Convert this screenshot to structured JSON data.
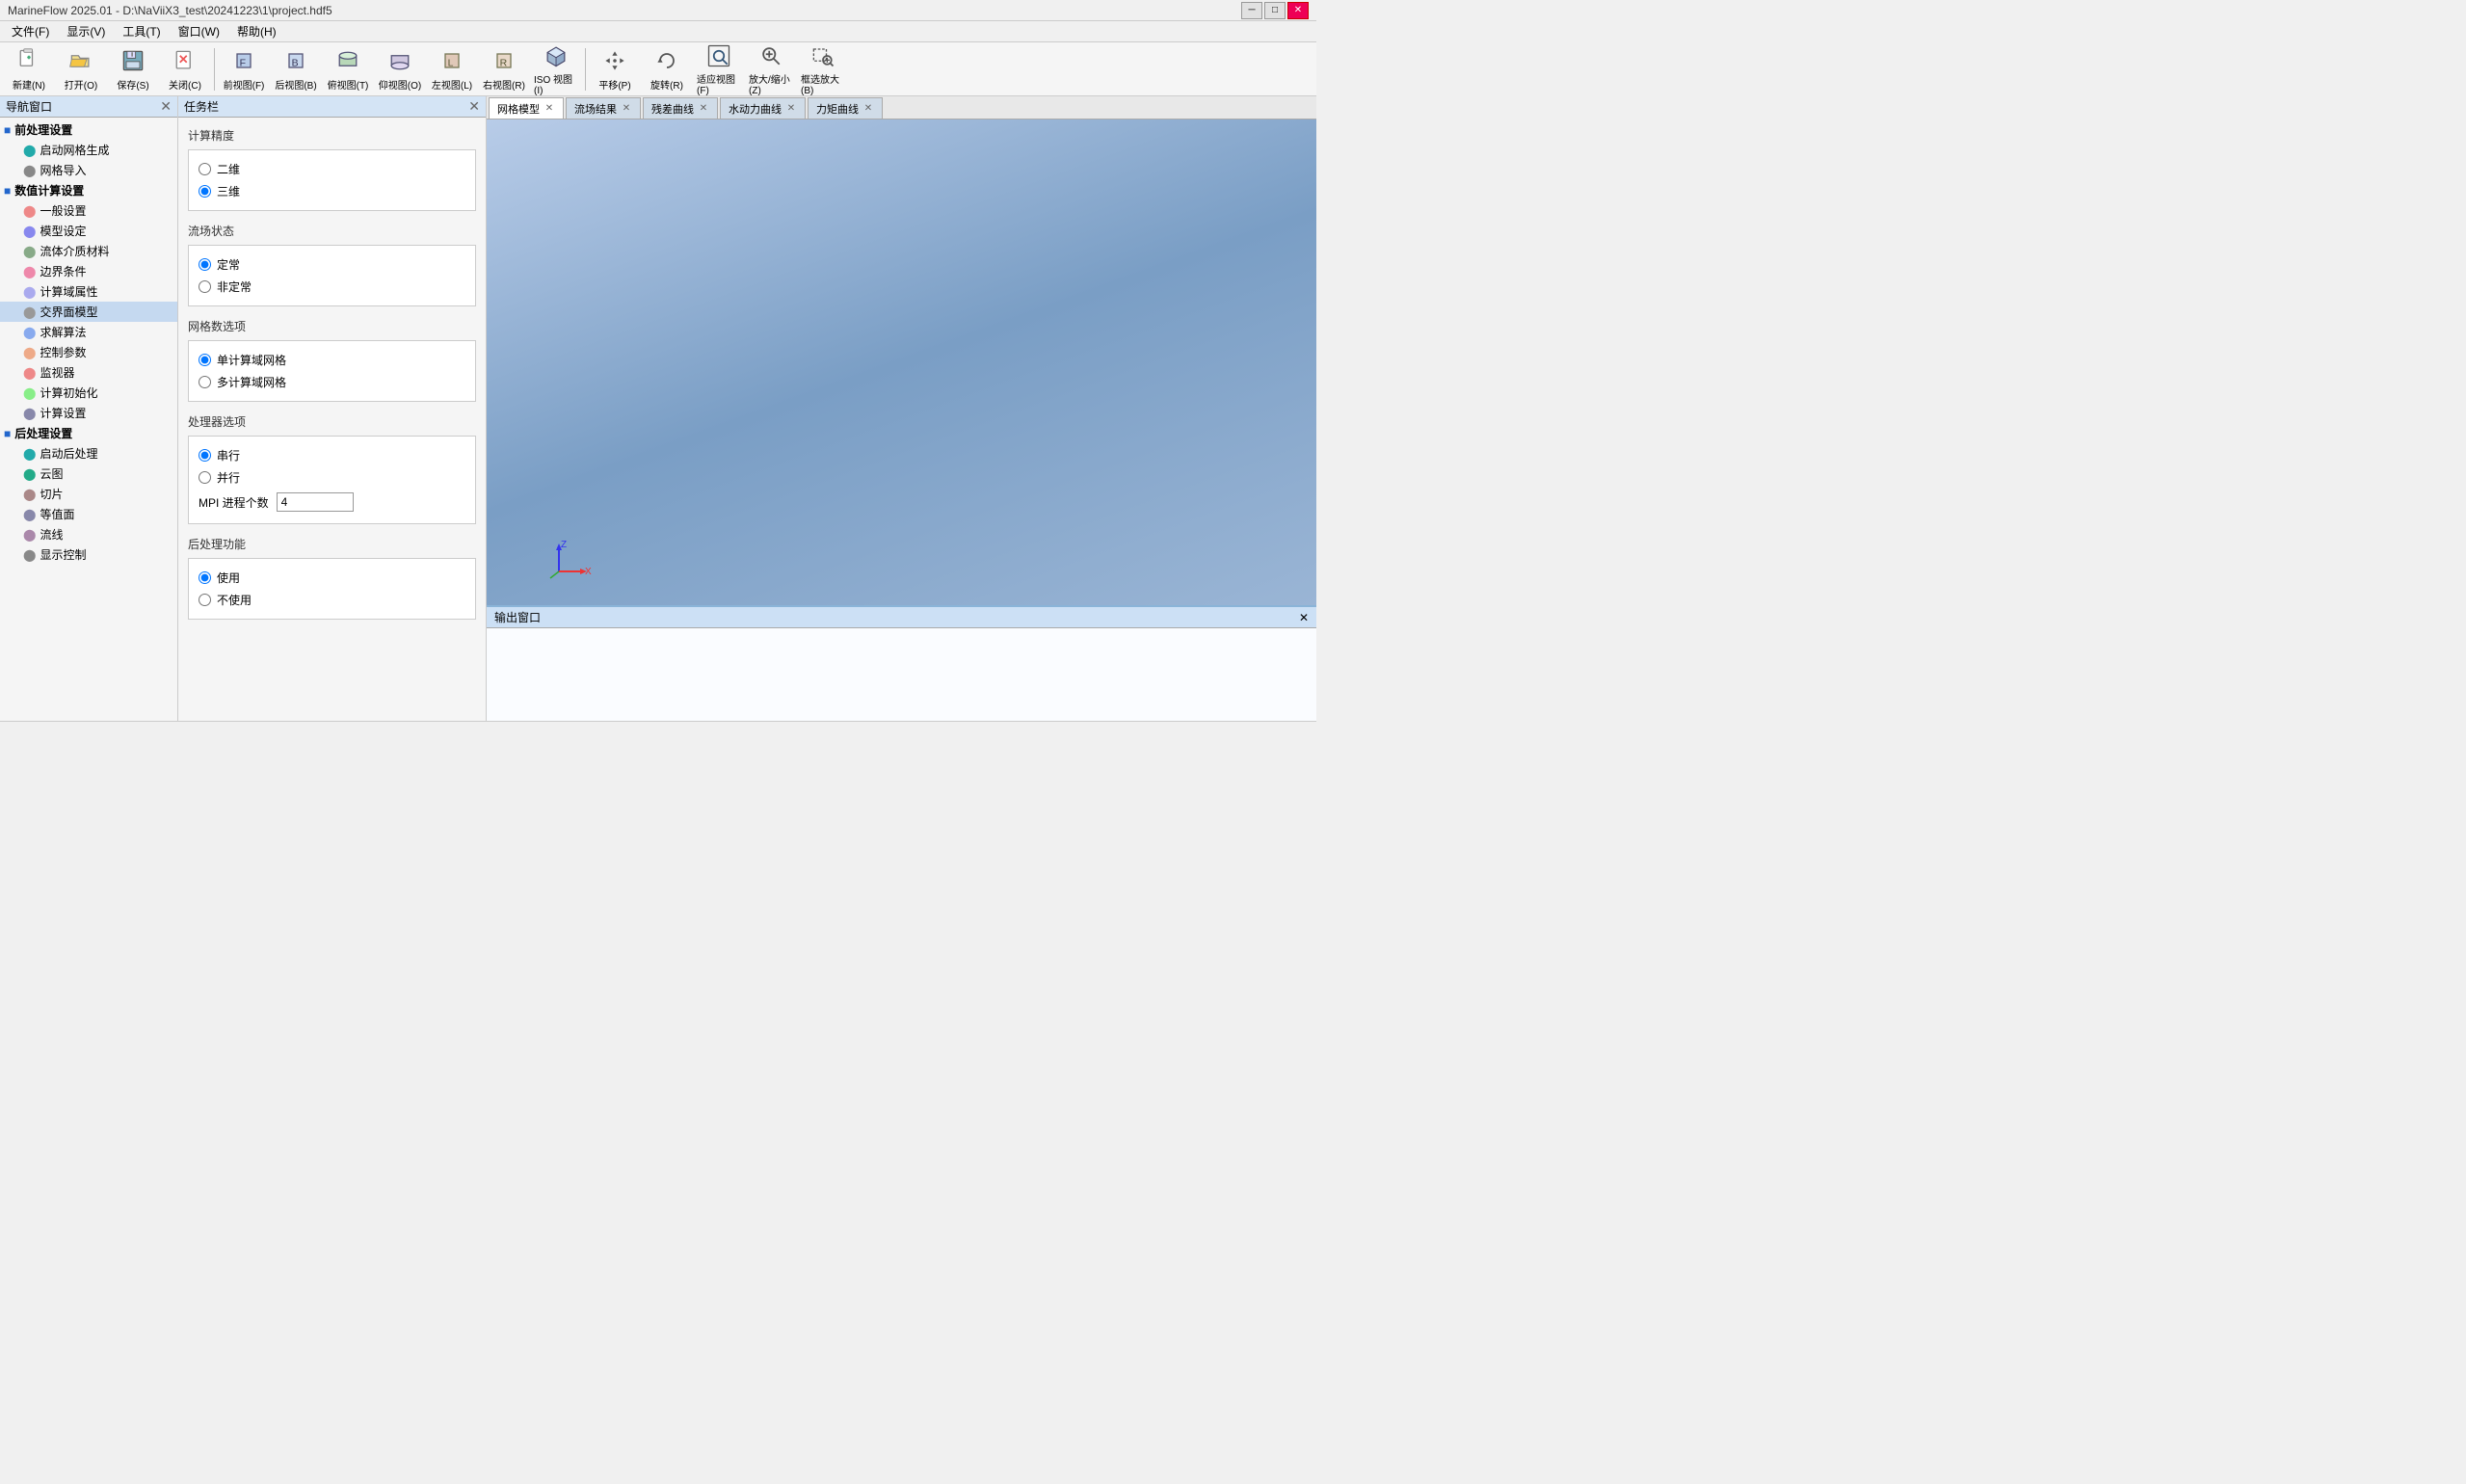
{
  "titleBar": {
    "title": "MarineFlow 2025.01 - D:\\NaViiX3_test\\20241223\\1\\project.hdf5",
    "minBtn": "─",
    "maxBtn": "□",
    "closeBtn": "✕"
  },
  "menuBar": {
    "items": [
      {
        "id": "file",
        "label": "文件(F)"
      },
      {
        "id": "view",
        "label": "显示(V)"
      },
      {
        "id": "tools",
        "label": "工具(T)"
      },
      {
        "id": "window",
        "label": "窗口(W)"
      },
      {
        "id": "help",
        "label": "帮助(H)"
      }
    ]
  },
  "toolbar": {
    "buttons": [
      {
        "id": "new",
        "label": "新建(N)"
      },
      {
        "id": "open",
        "label": "打开(O)"
      },
      {
        "id": "save",
        "label": "保存(S)"
      },
      {
        "id": "close",
        "label": "关闭(C)"
      },
      {
        "id": "front",
        "label": "前视图(F)"
      },
      {
        "id": "back",
        "label": "后视图(B)"
      },
      {
        "id": "top",
        "label": "俯视图(T)"
      },
      {
        "id": "bottom",
        "label": "仰视图(O)"
      },
      {
        "id": "left",
        "label": "左视图(L)"
      },
      {
        "id": "right",
        "label": "右视图(R)"
      },
      {
        "id": "iso",
        "label": "ISO 视图(I)"
      },
      {
        "id": "pan",
        "label": "平移(P)"
      },
      {
        "id": "rotate",
        "label": "旋转(R)"
      },
      {
        "id": "fitview",
        "label": "适应视图(F)"
      },
      {
        "id": "zoomfit",
        "label": "放大/缩小(Z)"
      },
      {
        "id": "zoomsel",
        "label": "框选放大(B)"
      }
    ]
  },
  "navPanel": {
    "title": "导航窗口",
    "sections": [
      {
        "id": "preprocess",
        "label": "前处理设置",
        "items": [
          {
            "id": "start-mesh",
            "label": "启动网格生成"
          },
          {
            "id": "import-mesh",
            "label": "网格导入"
          }
        ]
      },
      {
        "id": "numcalc",
        "label": "数值计算设置",
        "items": [
          {
            "id": "general",
            "label": "一般设置"
          },
          {
            "id": "model",
            "label": "模型设定"
          },
          {
            "id": "fluid",
            "label": "流体介质材料"
          },
          {
            "id": "boundary",
            "label": "边界条件"
          },
          {
            "id": "domain",
            "label": "计算域属性"
          },
          {
            "id": "interface",
            "label": "交界面模型",
            "selected": true
          },
          {
            "id": "solver",
            "label": "求解算法"
          },
          {
            "id": "control",
            "label": "控制参数"
          },
          {
            "id": "monitor",
            "label": "监视器"
          },
          {
            "id": "init",
            "label": "计算初始化"
          },
          {
            "id": "calcsettings",
            "label": "计算设置"
          }
        ]
      },
      {
        "id": "postprocess",
        "label": "后处理设置",
        "items": [
          {
            "id": "start-post",
            "label": "启动后处理"
          },
          {
            "id": "cloud",
            "label": "云图"
          },
          {
            "id": "slice",
            "label": "切片"
          },
          {
            "id": "contour",
            "label": "等值面"
          },
          {
            "id": "streamline",
            "label": "流线"
          },
          {
            "id": "display",
            "label": "显示控制"
          }
        ]
      }
    ]
  },
  "taskPanel": {
    "title": "任务栏",
    "sections": [
      {
        "id": "calc-precision",
        "title": "计算精度",
        "options": [
          {
            "id": "2d",
            "label": "二维",
            "checked": false
          },
          {
            "id": "3d",
            "label": "三维",
            "checked": true
          }
        ]
      },
      {
        "id": "flow-state",
        "title": "流场状态",
        "options": [
          {
            "id": "steady",
            "label": "定常",
            "checked": true
          },
          {
            "id": "unsteady",
            "label": "非定常",
            "checked": false
          }
        ]
      },
      {
        "id": "mesh-options",
        "title": "网格数选项",
        "options": [
          {
            "id": "single-mesh",
            "label": "单计算域网格",
            "checked": true
          },
          {
            "id": "multi-mesh",
            "label": "多计算域网格",
            "checked": false
          }
        ]
      },
      {
        "id": "processor-options",
        "title": "处理器选项",
        "options": [
          {
            "id": "serial",
            "label": "串行",
            "checked": true
          },
          {
            "id": "parallel",
            "label": "并行",
            "checked": false
          }
        ],
        "mpiLabel": "MPI 进程个数",
        "mpiValue": "4"
      },
      {
        "id": "post-function",
        "title": "后处理功能",
        "options": [
          {
            "id": "use-post",
            "label": "使用",
            "checked": true
          },
          {
            "id": "no-post",
            "label": "不使用",
            "checked": false
          }
        ]
      }
    ]
  },
  "viewTabs": [
    {
      "id": "mesh-model",
      "label": "网格模型",
      "active": true,
      "closable": true
    },
    {
      "id": "flow-results",
      "label": "流场结果",
      "active": false,
      "closable": true
    },
    {
      "id": "residual-curve",
      "label": "残差曲线",
      "active": false,
      "closable": true
    },
    {
      "id": "hydro-curve",
      "label": "水动力曲线",
      "active": false,
      "closable": true
    },
    {
      "id": "torque-curve",
      "label": "力矩曲线",
      "active": false,
      "closable": true
    }
  ],
  "outputPanel": {
    "title": "输出窗口"
  },
  "statusBar": {
    "text": ""
  },
  "colors": {
    "accent": "#4a90d9",
    "navBg": "#f5f5f5",
    "viewportBg1": "#b8cce8",
    "viewportBg2": "#7a9ec5"
  }
}
